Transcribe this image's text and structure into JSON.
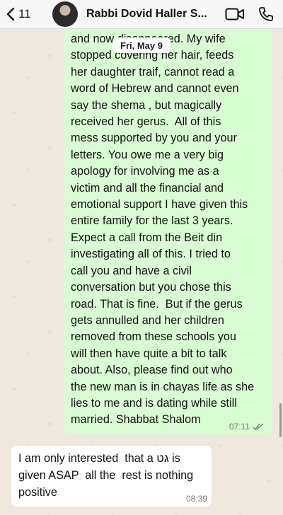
{
  "header": {
    "back_count": "11",
    "contact_name": "Rabbi Dovid Haller S...",
    "icons": [
      "chevron-left-icon",
      "video-call-icon",
      "phone-call-icon"
    ]
  },
  "date_chip": "Fri, May 9",
  "messages": [
    {
      "direction": "outgoing",
      "text": "and now disappeared. My wife\nstopped covering her hair, feeds\nher daughter traif, cannot read a\nword of Hebrew and cannot even\nsay the shema , but magically\nreceived her gerus.  All of this\nmess supported by you and your\nletters. You owe me a very big\napology for involving me as a\nvictim and all the financial and\nemotional support I have given this\nentire family for the last 3 years.\nExpect a call from the Beit din\ninvestigating all of this. I tried to\ncall you and have a civil\nconversation but you chose this\nroad. That is fine.  But if the gerus\ngets annulled and her children\nremoved from these schools you\nwill then have quite a bit to talk\nabout. Also, please find out who\nthe new man is in chayas life as she\nlies to me and is dating while still\nmarried. Shabbat Shalom",
      "time": "07:11",
      "status": "read"
    },
    {
      "direction": "incoming",
      "text": "I am only interested  that a גט is\ngiven ASAP  all the  rest is nothing\npositive",
      "time": "08:39"
    }
  ],
  "colors": {
    "outgoing_bubble": "#d9fdd3",
    "incoming_bubble": "#ffffff",
    "header_bg": "#f7f7f7",
    "wallpaper": "#efe8df"
  }
}
